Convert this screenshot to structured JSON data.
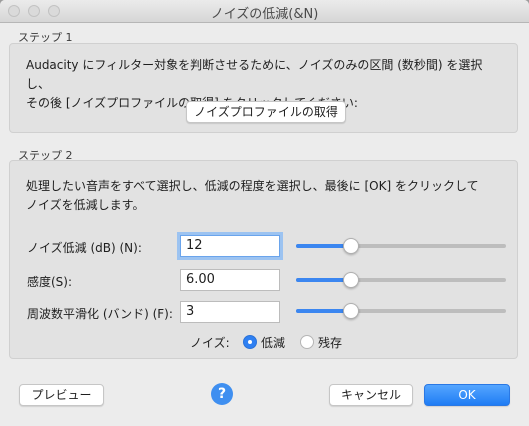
{
  "window": {
    "title": "ノイズの低減(&N)"
  },
  "step1": {
    "label": "ステップ 1",
    "text_line1": "Audacity にフィルター対象を判断させるために、ノイズのみの区間 (数秒間) を選択し、",
    "text_line2": "その後 [ノイズプロファイルの取得] をクリックしてください:",
    "button_label": "ノイズプロファイルの取得"
  },
  "step2": {
    "label": "ステップ 2",
    "text_line1": "処理したい音声をすべて選択し、低減の程度を選択し、最後に [OK] をクリックして",
    "text_line2": "ノイズを低減します。",
    "params": [
      {
        "label": "ノイズ低減 (dB) (N):",
        "value": "12",
        "slider_fraction": 0.26
      },
      {
        "label": "感度(S):",
        "value": "6.00",
        "slider_fraction": 0.26
      },
      {
        "label": "周波数平滑化 (バンド) (F):",
        "value": "3",
        "slider_fraction": 0.26
      }
    ],
    "noise_label": "ノイズ:",
    "radio_reduce": "低減",
    "radio_residue": "残存",
    "selected_radio": "reduce"
  },
  "footer": {
    "preview_label": "プレビュー",
    "help_glyph": "?",
    "cancel_label": "キャンセル",
    "ok_label": "OK"
  },
  "colors": {
    "accent": "#2f80f2",
    "window_bg": "#ececec",
    "group_bg": "#e2e2e2"
  }
}
